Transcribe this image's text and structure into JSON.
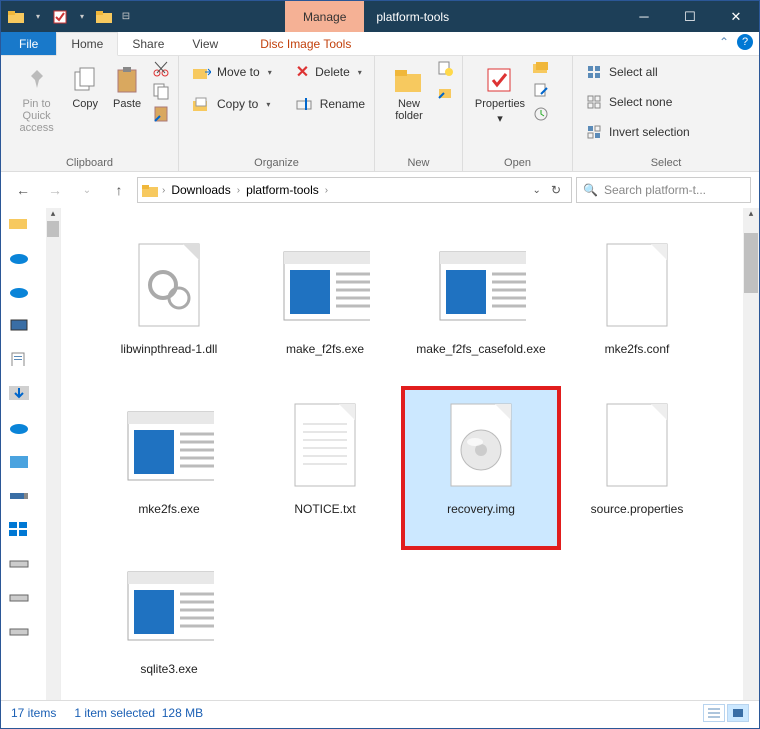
{
  "titlebar": {
    "contextual_label": "Manage",
    "window_title": "platform-tools"
  },
  "tabs": {
    "file": "File",
    "home": "Home",
    "share": "Share",
    "view": "View",
    "disc_tools": "Disc Image Tools"
  },
  "ribbon": {
    "clipboard": {
      "pin": "Pin to Quick access",
      "copy": "Copy",
      "paste": "Paste",
      "group": "Clipboard"
    },
    "organize": {
      "move_to": "Move to",
      "copy_to": "Copy to",
      "delete": "Delete",
      "rename": "Rename",
      "group": "Organize"
    },
    "new": {
      "new_folder": "New folder",
      "group": "New"
    },
    "open": {
      "properties": "Properties",
      "group": "Open"
    },
    "select": {
      "select_all": "Select all",
      "select_none": "Select none",
      "invert": "Invert selection",
      "group": "Select"
    }
  },
  "breadcrumb": {
    "seg1": "Downloads",
    "seg2": "platform-tools"
  },
  "search": {
    "placeholder": "Search platform-t..."
  },
  "files": [
    {
      "name": "libwinpthread-1.dll",
      "type": "dll"
    },
    {
      "name": "make_f2fs.exe",
      "type": "exe"
    },
    {
      "name": "make_f2fs_casefold.exe",
      "type": "exe"
    },
    {
      "name": "mke2fs.conf",
      "type": "blank"
    },
    {
      "name": "mke2fs.exe",
      "type": "exe"
    },
    {
      "name": "NOTICE.txt",
      "type": "txt"
    },
    {
      "name": "recovery.img",
      "type": "img",
      "selected": true,
      "highlight": true
    },
    {
      "name": "source.properties",
      "type": "blank"
    },
    {
      "name": "sqlite3.exe",
      "type": "exe"
    }
  ],
  "status": {
    "count": "17 items",
    "selection": "1 item selected",
    "size": "128 MB"
  }
}
